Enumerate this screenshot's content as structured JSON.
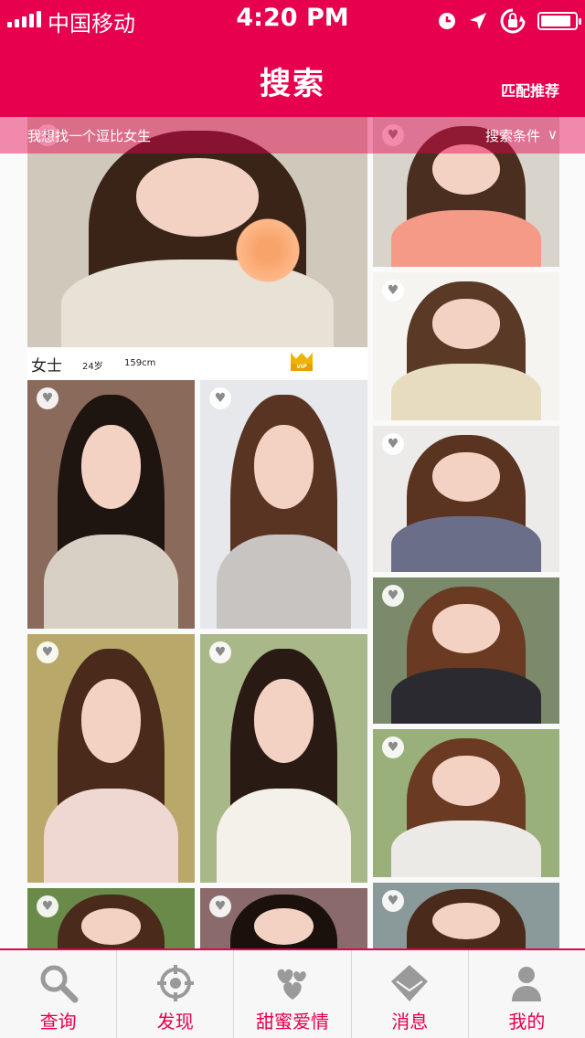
{
  "status_bar": {
    "carrier": "中国移动",
    "time": "4:20 PM",
    "battery_level": 0.9,
    "icons": [
      "alarm-icon",
      "location-arrow-icon",
      "rotation-lock-icon",
      "battery-icon"
    ]
  },
  "header": {
    "title": "搜索",
    "right_button": "匹配推荐"
  },
  "search_bar": {
    "prompt": "我想找一个逗比女生",
    "conditions_label": "搜索条件",
    "conditions_icon": "chevron-down-icon"
  },
  "featured": {
    "name": "女士",
    "age": "24岁",
    "height": "159cm",
    "badge": "VIP",
    "badge_icon": "crown-icon",
    "favorite_icon": "heart-icon"
  },
  "colors": {
    "brand": "#e6004d",
    "tab_text": "#e6004d",
    "badge_gold": "#f0b400"
  },
  "tabs": [
    {
      "label": "查询",
      "icon": "search-icon"
    },
    {
      "label": "发现",
      "icon": "crosshair-icon"
    },
    {
      "label": "甜蜜爱情",
      "icon": "hearts-icon"
    },
    {
      "label": "消息",
      "icon": "envelope-icon"
    },
    {
      "label": "我的",
      "icon": "person-icon"
    }
  ]
}
